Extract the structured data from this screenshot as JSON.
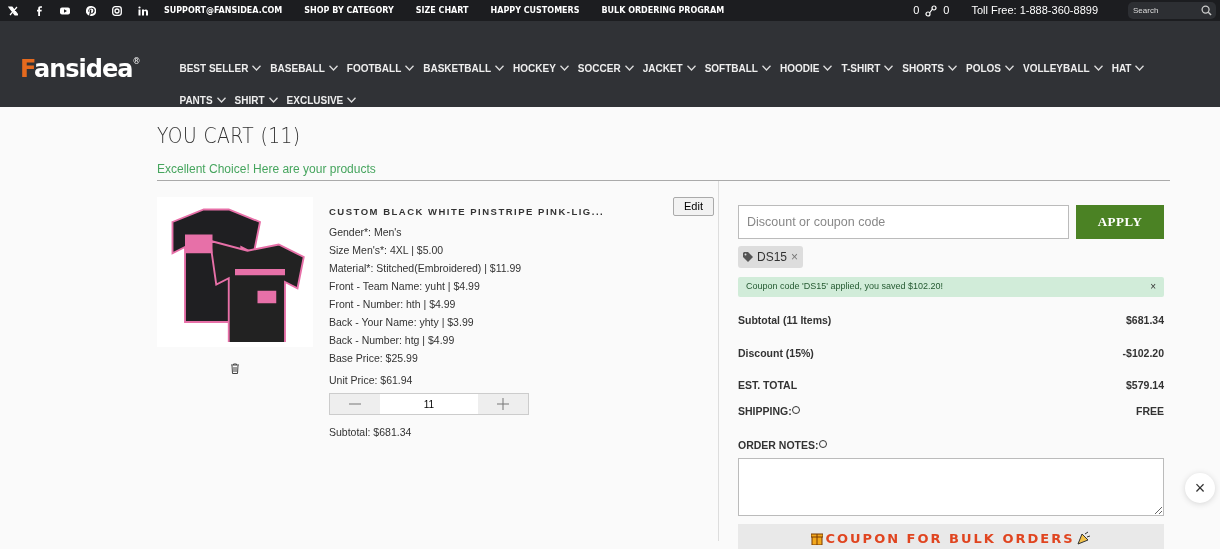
{
  "top_bar": {
    "links": [
      "SUPPORT@FANSIDEA.COM",
      "SHOP BY CATEGORY",
      "SIZE CHART",
      "HAPPY CUSTOMERS",
      "BULK ORDERING PROGRAM"
    ],
    "cart_count": "0",
    "wishlist_count": "0",
    "phone": "Toll Free: 1-888-360-8899",
    "search": {
      "placeholder": "Search"
    }
  },
  "logo": {
    "text": "Fansidea",
    "mark": "®"
  },
  "nav": [
    "BEST SELLER",
    "BASEBALL",
    "FOOTBALL",
    "BASKETBALL",
    "HOCKEY",
    "SOCCER",
    "JACKET",
    "SOFTBALL",
    "HOODIE",
    "T-SHIRT",
    "SHORTS",
    "POLOS",
    "VOLLEYBALL",
    "HAT",
    "PANTS",
    "SHIRT",
    "EXCLUSIVE"
  ],
  "page_title": "YOU CART (11)",
  "subtitle": "Excellent Choice! Here are your products",
  "cart_item": {
    "title": "CUSTOM BLACK WHITE PINSTRIPE PINK-LIG...",
    "edit": "Edit",
    "options": [
      "Gender*: Men's",
      "Size Men's*: 4XL | $5.00",
      "Material*: Stitched(Embroidered) | $11.99",
      "Front - Team Name: yuht | $4.99",
      "Front - Number: hth | $4.99",
      "Back - Your Name: yhty | $3.99",
      "Back - Number: htg | $4.99",
      "Base Price: $25.99"
    ],
    "unit_price": "Unit Price: $61.94",
    "quantity": "11",
    "subtotal": "Subtotal: $681.34"
  },
  "coupon": {
    "placeholder": "Discount or coupon code",
    "button": "APPLY",
    "tag": "DS15",
    "remove": "×",
    "message": "Coupon code 'DS15' applied, you saved $102.20!",
    "dismiss": "×"
  },
  "summary": [
    {
      "label": "Subtotal (11 Items)",
      "value": "$681.34"
    },
    {
      "label": "Discount (15%)",
      "value": "-$102.20"
    },
    {
      "label": "EST. TOTAL",
      "value": "$579.14"
    },
    {
      "label": "SHIPPING:",
      "value": "FREE"
    }
  ],
  "order_notes": {
    "label": "ORDER NOTES:"
  },
  "bulk_banner": "COUPON FOR BULK ORDERS",
  "close": "×"
}
